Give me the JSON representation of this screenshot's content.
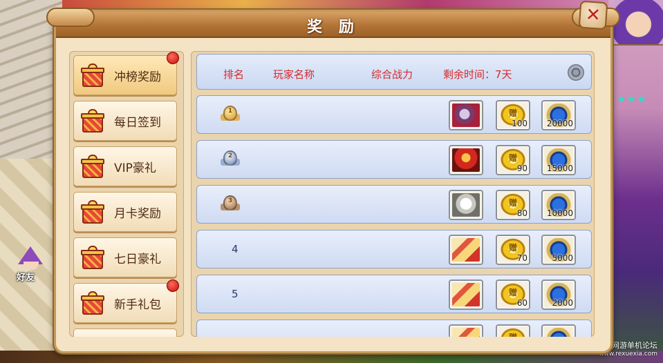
{
  "dialog": {
    "title": "奖 励",
    "close_symbol": "✕"
  },
  "sidebar": {
    "items": [
      {
        "label": "冲榜奖励",
        "active": true,
        "badge": true
      },
      {
        "label": "每日签到",
        "active": false,
        "badge": false
      },
      {
        "label": "VIP豪礼",
        "active": false,
        "badge": false
      },
      {
        "label": "月卡奖励",
        "active": false,
        "badge": false
      },
      {
        "label": "七日豪礼",
        "active": false,
        "badge": false
      },
      {
        "label": "新手礼包",
        "active": false,
        "badge": true
      }
    ]
  },
  "header": {
    "rank": "排名",
    "player_name": "玩家名称",
    "power": "综合战力",
    "time_left": "剩余时间：7天",
    "settings_icon": "settings-icon"
  },
  "rows": [
    {
      "rank": "1",
      "badge": "gold",
      "item_art": "beast",
      "gold_qty": "100",
      "orb_qty": "20000"
    },
    {
      "rank": "2",
      "badge": "silver",
      "item_art": "red",
      "gold_qty": "90",
      "orb_qty": "15000"
    },
    {
      "rank": "3",
      "badge": "bronze",
      "item_art": "white",
      "gold_qty": "80",
      "orb_qty": "10000"
    },
    {
      "rank": "4",
      "badge": "",
      "item_art": "scroll",
      "gold_qty": "70",
      "orb_qty": "5000"
    },
    {
      "rank": "5",
      "badge": "",
      "item_art": "scroll",
      "gold_qty": "60",
      "orb_qty": "2000"
    },
    {
      "rank": "",
      "badge": "",
      "item_art": "scroll",
      "gold_qty": "",
      "orb_qty": ""
    }
  ],
  "gold_glyph": "赠",
  "overlay": {
    "friend_label": "好友",
    "watermark_line1": "热血侠网游单机论坛",
    "watermark_line2": "www.rexuexia.com"
  },
  "colors": {
    "header_text": "#d6282a",
    "panel_bg": "#f4e3c4",
    "row_bg": "#cfdbf2",
    "badge_red": "#c80d0d"
  }
}
